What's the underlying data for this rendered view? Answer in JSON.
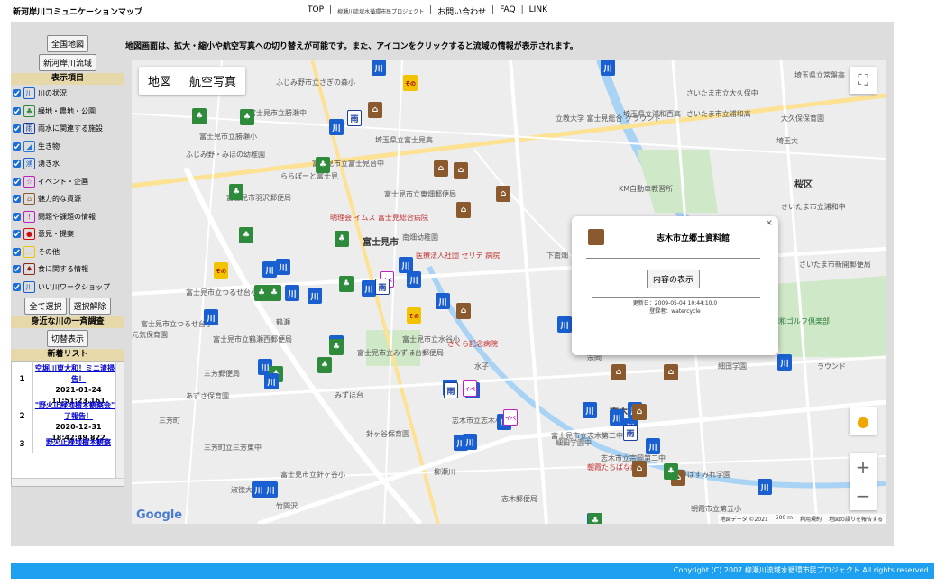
{
  "header": {
    "site_title": "新河岸川コミュニケーションマップ",
    "nav": [
      "TOP",
      "柳瀬川流域水循環市民プロジェクト",
      "お問い合わせ",
      "FAQ",
      "LINK"
    ]
  },
  "sidebar": {
    "btn_national": "全国地図",
    "btn_basin": "新河岸川流域",
    "display_heading": "表示項目",
    "items": [
      {
        "label": "川の状況",
        "icon": "river-icon",
        "color": "#1a5fd0"
      },
      {
        "label": "緑地・農地・公園",
        "icon": "tree-icon",
        "color": "#2e8b3c"
      },
      {
        "label": "雨水に関連する施設",
        "icon": "rain-icon",
        "color": "#1a3ea0"
      },
      {
        "label": "生き物",
        "icon": "fish-icon",
        "color": "#2a7ad0"
      },
      {
        "label": "湧き水",
        "icon": "spring-icon",
        "color": "#1a5fd0"
      },
      {
        "label": "イベント・企画",
        "icon": "event-icon",
        "color": "#c020c0"
      },
      {
        "label": "魅力的な資源",
        "icon": "house-icon",
        "color": "#8a5a2e"
      },
      {
        "label": "問題や課題の情報",
        "icon": "warning-icon",
        "color": "#c020c0"
      },
      {
        "label": "意見・提案",
        "icon": "person-icon",
        "color": "#d01010"
      },
      {
        "label": "その他",
        "icon": "other-icon",
        "color": "#f2c400"
      },
      {
        "label": "食に関する情報",
        "icon": "food-icon",
        "color": "#8a2a1a"
      },
      {
        "label": "いい川ワークショップ",
        "icon": "workshop-icon",
        "color": "#1a5fd0"
      }
    ],
    "btn_select_all": "全て選択",
    "btn_deselect": "選択解除",
    "survey_heading": "身近な川の一斉調査",
    "btn_toggle": "切替表示",
    "news_heading": "新着リスト",
    "news": [
      {
        "num": "1",
        "title": "空堀川東大和！ミニ清掃報告！",
        "date": "2021-01-24",
        "time": "11:51:23.161"
      },
      {
        "num": "2",
        "title": "\"野火止緑地樹木観察会\"終了報告！",
        "date": "2020-12-31",
        "time": "18:42:49.822"
      },
      {
        "num": "3",
        "title": "野火止緑地樹木観察",
        "date": "",
        "time": ""
      }
    ]
  },
  "main": {
    "description": "地図画面は、拡大・縮小や航空写真への切り替えが可能です。また、アイコンをクリックすると流域の情報が表示されます。"
  },
  "map": {
    "type_map": "地図",
    "type_satellite": "航空写真",
    "google": "Google",
    "attribution": [
      "地図データ ©2021",
      "500 m",
      "利用規約",
      "地図の誤りを報告する"
    ],
    "places": [
      {
        "t": "ふじみ野市立さぎの森小"
      },
      {
        "t": "富士見市立勝瀬中"
      },
      {
        "t": "富士見市立勝瀬小"
      },
      {
        "t": "ふじみ野・みほの幼稚園"
      },
      {
        "t": "埼玉県立富士見高"
      },
      {
        "t": "ららぽーと富士見"
      },
      {
        "t": "富士見市立富士見台中"
      },
      {
        "t": "富士見市羽沢郵便局"
      },
      {
        "t": "富士見市立東畑郵便局"
      },
      {
        "t": "明理会 イムス 富士見総合病院",
        "c": "red"
      },
      {
        "t": "富士見市",
        "c": "big"
      },
      {
        "t": "南畑幼稚園"
      },
      {
        "t": "医療法人社団 セリテ 病院",
        "c": "red"
      },
      {
        "t": "富士見市立つるせ台小"
      },
      {
        "t": "富士見市立鶴瀬西郵便局"
      },
      {
        "t": "富士見市立みずほ台郵便局"
      },
      {
        "t": "富士見市立水谷小"
      },
      {
        "t": "さくら記念病院",
        "c": "red"
      },
      {
        "t": "三芳郵便局"
      },
      {
        "t": "みずほ台"
      },
      {
        "t": "志木市立志木小"
      },
      {
        "t": "針ヶ谷保育園"
      },
      {
        "t": "三芳町立三芳東中"
      },
      {
        "t": "柳瀬川"
      },
      {
        "t": "朝霞たちばな病院",
        "c": "red"
      },
      {
        "t": "志木郵便局"
      },
      {
        "t": "富士見市立志木第二中"
      },
      {
        "t": "志木市",
        "c": "big"
      },
      {
        "t": "細田学園中"
      },
      {
        "t": "志木市立宗岡第二中"
      },
      {
        "t": "みつばすみれ学園"
      },
      {
        "t": "朝霞市立第五小"
      },
      {
        "t": "さいたま市立大久保中"
      },
      {
        "t": "埼玉県立常盤高"
      },
      {
        "t": "埼玉県立浦和西高"
      },
      {
        "t": "さいたま市立浦和高"
      },
      {
        "t": "立教大学 富士見総合 グラウンド"
      },
      {
        "t": "KM自動車教習所"
      },
      {
        "t": "桜区",
        "c": "big"
      },
      {
        "t": "さいたま市立浦和中"
      },
      {
        "t": "さいたま市立新開小"
      },
      {
        "t": "さいたま市新開郵便局"
      },
      {
        "t": "浦和ゴルフ倶楽部",
        "c": "grn"
      },
      {
        "t": "細田学園"
      },
      {
        "t": "ラウンド"
      },
      {
        "t": "埼玉大"
      },
      {
        "t": "大久保保育園"
      },
      {
        "t": "富士見市立つるせ台小"
      },
      {
        "t": "元気保育園"
      },
      {
        "t": "三芳町"
      },
      {
        "t": "あずさ保育園"
      },
      {
        "t": "淑徳大"
      },
      {
        "t": "竹間沢"
      },
      {
        "t": "水子"
      },
      {
        "t": "富士見市立針ヶ谷小"
      },
      {
        "t": "鶴瀬"
      },
      {
        "t": "下南畑"
      },
      {
        "t": "宗岡"
      }
    ]
  },
  "popup": {
    "name": "志木市立郷土資料館",
    "button": "内容の表示",
    "updated": "更新日：2009-05-04 10:44:10.0",
    "registrant": "登録者：watercycle"
  },
  "footer": {
    "copyright": "Copyright (C) 2007 柳瀬川流域水循環市民プロジェクト All rights reserved."
  }
}
